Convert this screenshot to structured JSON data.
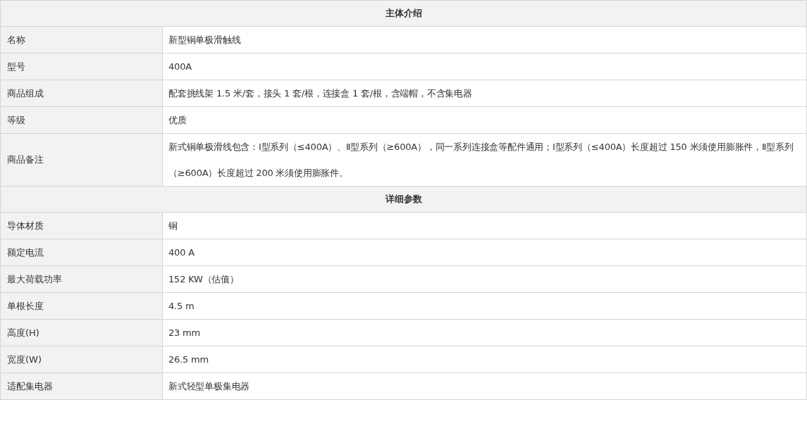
{
  "sections": [
    {
      "title": "主体介绍",
      "rows": [
        {
          "label": "名称",
          "value": "新型铜单极滑触线"
        },
        {
          "label": "型号",
          "value": "400A"
        },
        {
          "label": "商品组成",
          "value": "配套挑线架 1.5 米/套，接头 1 套/根，连接盒 1 套/根，含端帽，不含集电器"
        },
        {
          "label": "等级",
          "value": "优质"
        },
        {
          "label": "商品备注",
          "value": "新式铜单极滑线包含：Ⅰ型系列（≤400A）、Ⅱ型系列（≥600A），同一系列连接盒等配件通用；Ⅰ型系列（≤400A）长度超过 150 米须使用膨胀件，Ⅱ型系列（≥600A）长度超过 200 米须使用膨胀件。"
        }
      ]
    },
    {
      "title": "详细参数",
      "rows": [
        {
          "label": "导体材质",
          "value": "铜"
        },
        {
          "label": "额定电流",
          "value": "400 A"
        },
        {
          "label": "最大荷载功率",
          "value": "152 KW（估值）"
        },
        {
          "label": "单根长度",
          "value": "4.5 m"
        },
        {
          "label": "高度(H)",
          "value": "23 mm"
        },
        {
          "label": "宽度(W)",
          "value": "26.5 mm"
        },
        {
          "label": "适配集电器",
          "value": "新式轻型单极集电器"
        }
      ]
    }
  ]
}
